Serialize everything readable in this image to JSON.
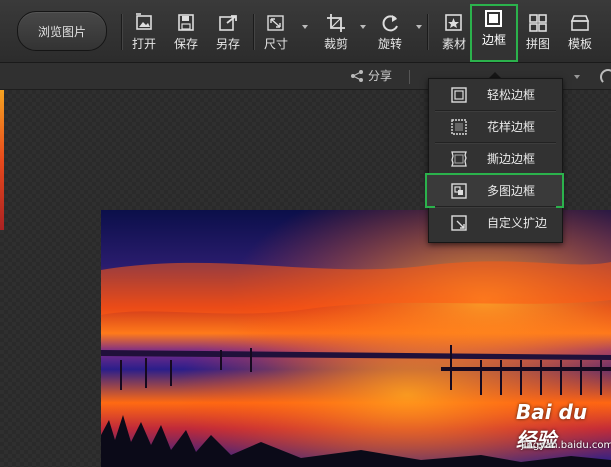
{
  "toolbar": {
    "browse_label": "浏览图片",
    "tools": [
      {
        "label": "打开",
        "icon": "open-image-icon"
      },
      {
        "label": "保存",
        "icon": "save-icon"
      },
      {
        "label": "另存",
        "icon": "save-as-icon"
      },
      {
        "label": "尺寸",
        "icon": "resize-icon"
      },
      {
        "label": "裁剪",
        "icon": "crop-icon"
      },
      {
        "label": "旋转",
        "icon": "rotate-icon"
      },
      {
        "label": "素材",
        "icon": "material-icon"
      },
      {
        "label": "边框",
        "icon": "border-icon",
        "active": true
      },
      {
        "label": "拼图",
        "icon": "collage-icon"
      },
      {
        "label": "模板",
        "icon": "template-icon"
      }
    ]
  },
  "subbar": {
    "share_label": "分享"
  },
  "border_menu": {
    "items": [
      {
        "label": "轻松边框",
        "icon": "simple-border-icon"
      },
      {
        "label": "花样边框",
        "icon": "pattern-border-icon"
      },
      {
        "label": "撕边边框",
        "icon": "torn-border-icon"
      },
      {
        "label": "多图边框",
        "icon": "multi-photo-border-icon",
        "highlighted": true
      },
      {
        "label": "自定义扩边",
        "icon": "custom-extend-icon"
      }
    ]
  },
  "watermark": {
    "logo": "Bai du 经验",
    "url": "jingyan.baidu.com"
  },
  "colors": {
    "highlight": "#2bb24c",
    "toolbar_bg": "#333333"
  }
}
